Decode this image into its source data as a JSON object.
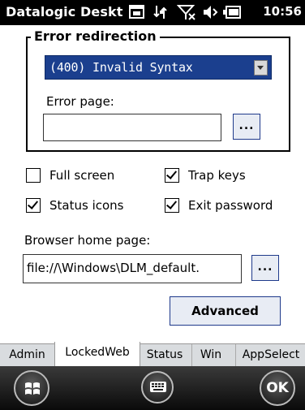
{
  "titlebar": {
    "title": "Datalogic Deskt",
    "time": "10:56",
    "icons": [
      "window-icon",
      "connectivity-icon",
      "signal-off-icon",
      "volume-icon",
      "battery-icon"
    ]
  },
  "error_group": {
    "legend": "Error redirection",
    "selected_error": "(400) Invalid Syntax",
    "error_page_label": "Error page:",
    "error_page_value": "",
    "browse_label": "..."
  },
  "options": {
    "full_screen": {
      "label": "Full screen",
      "checked": false
    },
    "trap_keys": {
      "label": "Trap keys",
      "checked": true
    },
    "status_icons": {
      "label": "Status icons",
      "checked": true
    },
    "exit_password": {
      "label": "Exit password",
      "checked": true
    }
  },
  "home": {
    "label": "Browser home page:",
    "value": "file://\\Windows\\DLM_default.",
    "browse_label": "..."
  },
  "advanced_label": "Advanced",
  "tabs": [
    "Admin",
    "LockedWeb",
    "Status",
    "Win",
    "AppSelect"
  ],
  "active_tab": "LockedWeb",
  "bottom": {
    "ok_label": "OK"
  },
  "colors": {
    "select_bg": "#1b3f8e",
    "button_border": "#1f3a8b"
  }
}
